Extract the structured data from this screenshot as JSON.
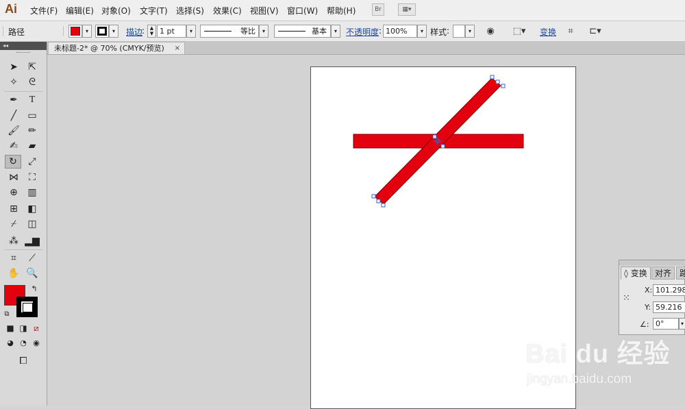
{
  "app": {
    "logo": "Ai"
  },
  "menu": {
    "items": [
      "文件(F)",
      "编辑(E)",
      "对象(O)",
      "文字(T)",
      "选择(S)",
      "效果(C)",
      "视图(V)",
      "窗口(W)",
      "帮助(H)"
    ],
    "bridge_label": "Br"
  },
  "control_bar": {
    "object_type": "路径",
    "stroke_link": "描边",
    "stroke_weight": "1 pt",
    "profile_label": "等比",
    "brush_label": "基本",
    "opacity_link": "不透明度",
    "opacity_value": "100%",
    "style_label": "样式",
    "transform_link": "变换"
  },
  "document": {
    "tab_title": "未标题-2* @ 70% (CMYK/预览)",
    "close_glyph": "×"
  },
  "tools": {
    "collapse_glyph": "◂◂",
    "fill_color": "#e3000f",
    "stroke_color": "#000000"
  },
  "artwork": {
    "fill_color": "#e3000f",
    "stroke_color": "#7a0000",
    "selection_color": "#3a5fcd"
  },
  "transform_panel": {
    "tabs": [
      "变换",
      "对齐",
      "路"
    ],
    "x_label": "X:",
    "x_value": "101.298",
    "y_label": "Y:",
    "y_value": "59.216",
    "angle_value": "0°"
  },
  "watermark": {
    "brand": "Bai du 经验",
    "url": "jingyan.baidu.com"
  }
}
